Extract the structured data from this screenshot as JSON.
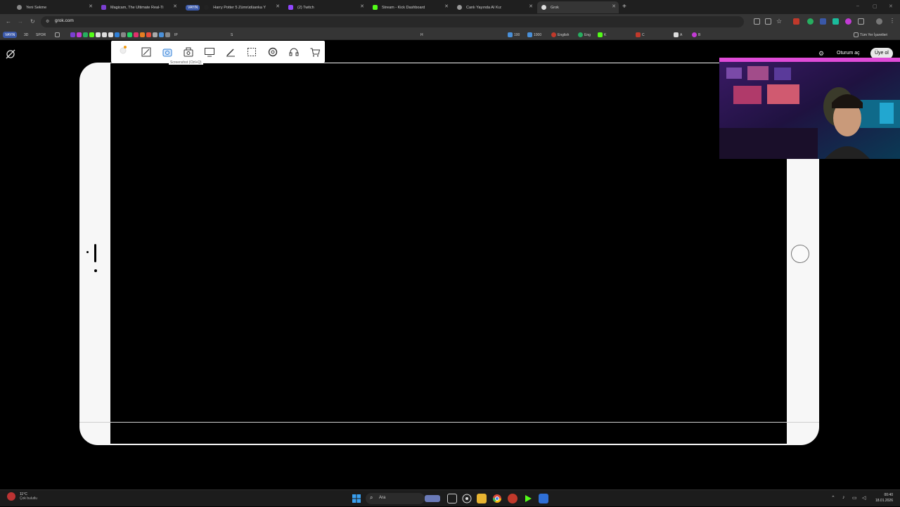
{
  "browser": {
    "tabs": [
      {
        "label": "Yeni Sekme",
        "active": false
      },
      {
        "label": "Magicam, The Ultimate Real-Ti",
        "active": false
      },
      {
        "label": "Harry Potter 5 Zümrüdüanka Y",
        "badge": "VAYIN",
        "active": false
      },
      {
        "label": "(2) Twitch",
        "active": false
      },
      {
        "label": "Stream - Kick Dashboard",
        "active": false
      },
      {
        "label": "Canlı Yayında AI Kız",
        "active": false
      },
      {
        "label": "Grok",
        "active": true
      }
    ],
    "new_tab": "+",
    "url": "grok.com",
    "window_controls": {
      "minimize": "–",
      "maximize": "▢",
      "close": "✕"
    }
  },
  "bookmarks": {
    "items": [
      "VAYIN",
      "3D",
      "SPOR"
    ],
    "extra": [
      "IP",
      "S",
      "H",
      "100",
      "1000",
      "English",
      "Eng",
      "K",
      "C",
      "A",
      "B"
    ],
    "all_bookmarks": "Tüm Yer İşaretleri"
  },
  "page": {
    "signin": "Oturum aç",
    "signup": "Üye ol"
  },
  "capture_toolbar": {
    "tooltip": "Screenshot (Ctrl+Q)",
    "buttons": [
      "resize-icon",
      "screenshot-icon",
      "record-icon",
      "screen-icon",
      "pen-icon",
      "select-region-icon",
      "settings-icon",
      "headset-icon",
      "cart-icon"
    ]
  },
  "taskbar": {
    "weather_temp": "11°C",
    "weather_desc": "Çok bulutlu",
    "search_label": "Ara",
    "time": "00:40",
    "date": "18.01.2026"
  },
  "colors": {
    "accent": "#3a58a8",
    "tablet_body": "#f7f7f7",
    "screen": "#000000"
  }
}
